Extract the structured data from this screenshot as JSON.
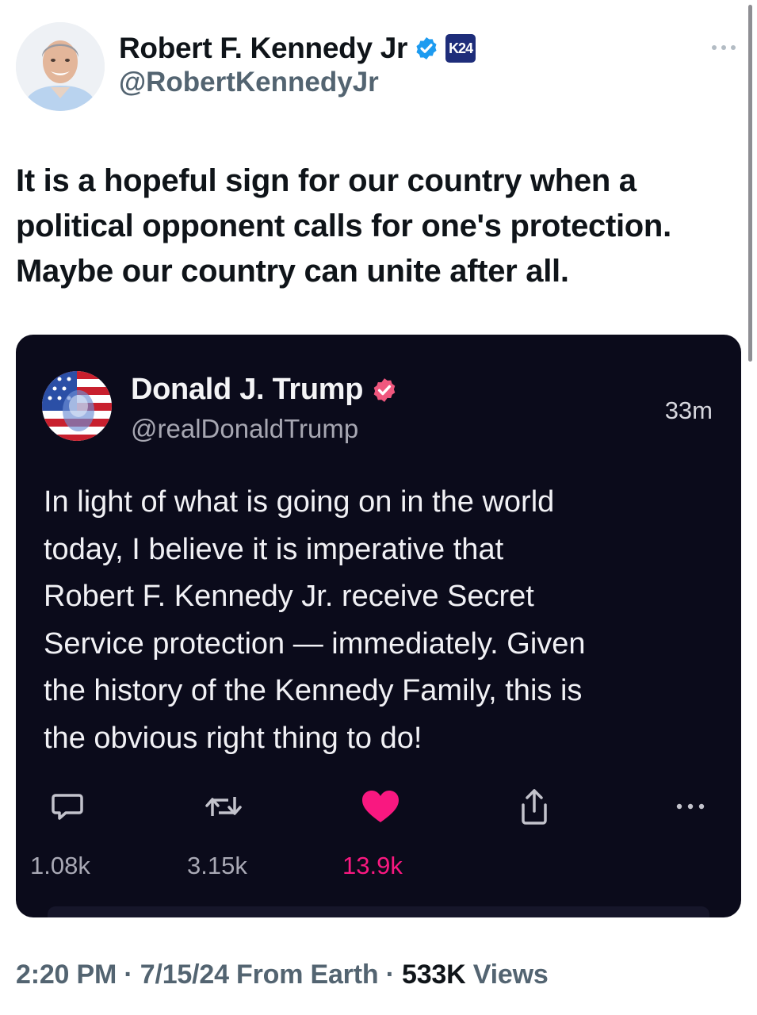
{
  "author": {
    "name": "Robert F. Kennedy Jr",
    "handle": "@RobertKennedyJr",
    "affiliate_badge": "K24",
    "verified_color": "#1d9bf0",
    "avatar": "avatar-icon"
  },
  "tweet": {
    "lines": [
      "It is a hopeful sign for our country when a",
      "political opponent calls for one's protection.",
      "Maybe our country can unite after all."
    ]
  },
  "quoted": {
    "name": "Donald J. Trump",
    "handle": "@realDonaldTrump",
    "time": "33m",
    "verified_color": "#f0577e",
    "lines": [
      "In light of what is going on in the world",
      "today, I believe it is imperative that",
      "Robert F. Kennedy Jr. receive Secret",
      "Service protection — immediately. Given",
      "the history of the Kennedy Family, this is",
      "the obvious right thing to do!"
    ],
    "actions": {
      "reply_count": "1.08k",
      "repost_count": "3.15k",
      "like_count": "13.9k",
      "like_color": "#f91880"
    }
  },
  "meta": {
    "time": "2:20 PM",
    "separator": " · ",
    "date": "7/15/24",
    "source": "From Earth",
    "views_count": "533K",
    "views_label": "Views"
  }
}
